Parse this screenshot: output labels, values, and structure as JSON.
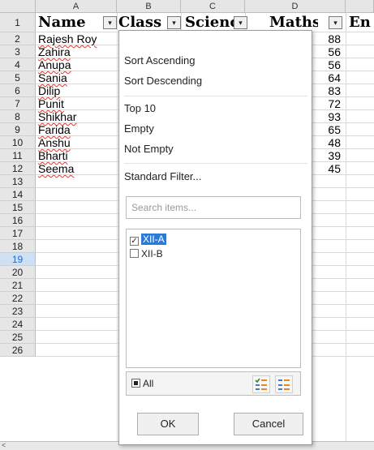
{
  "columns": [
    "A",
    "B",
    "C",
    "D"
  ],
  "rows": [
    "1",
    "2",
    "3",
    "4",
    "5",
    "6",
    "7",
    "8",
    "9",
    "10",
    "11",
    "12",
    "13",
    "14",
    "15",
    "16",
    "17",
    "18",
    "19",
    "20",
    "21",
    "22",
    "23",
    "24",
    "25",
    "26"
  ],
  "active_row": "19",
  "header_row": {
    "name": "Name",
    "class": "Class",
    "science": "Science",
    "maths": "Maths",
    "e": "En"
  },
  "dropdown_glyph": "▾",
  "students": [
    {
      "name": "Rajesh Roy",
      "maths": "88"
    },
    {
      "name": "Zahira",
      "maths": "56"
    },
    {
      "name": "Anupa",
      "maths": "56"
    },
    {
      "name": "Sania",
      "maths": "64"
    },
    {
      "name": "Dilip",
      "maths": "83"
    },
    {
      "name": "Punit",
      "maths": "72"
    },
    {
      "name": "Shikhar",
      "maths": "93"
    },
    {
      "name": "Farida",
      "maths": "65"
    },
    {
      "name": "Anshu",
      "maths": "48"
    },
    {
      "name": "Bharti",
      "maths": "39"
    },
    {
      "name": "Seema",
      "maths": "45"
    }
  ],
  "autofilter": {
    "sort_ascending": "Sort Ascending",
    "sort_descending": "Sort Descending",
    "top10": "Top 10",
    "empty": "Empty",
    "not_empty": "Not Empty",
    "standard_filter": "Standard Filter...",
    "search_placeholder": "Search items...",
    "items": [
      {
        "label": "XII-A",
        "checked": true
      },
      {
        "label": "XII-B",
        "checked": false
      }
    ],
    "all_label": "All",
    "ok_label": "OK",
    "cancel_label": "Cancel",
    "check_glyph": "✓"
  },
  "colors": {
    "selection": "#2c7ad6",
    "header_bg": "#e6e6e6",
    "active_row_bg": "#cfe0f3"
  },
  "icons": {
    "select_current_only": "select-current-icon",
    "unselect_current": "unselect-current-icon"
  }
}
